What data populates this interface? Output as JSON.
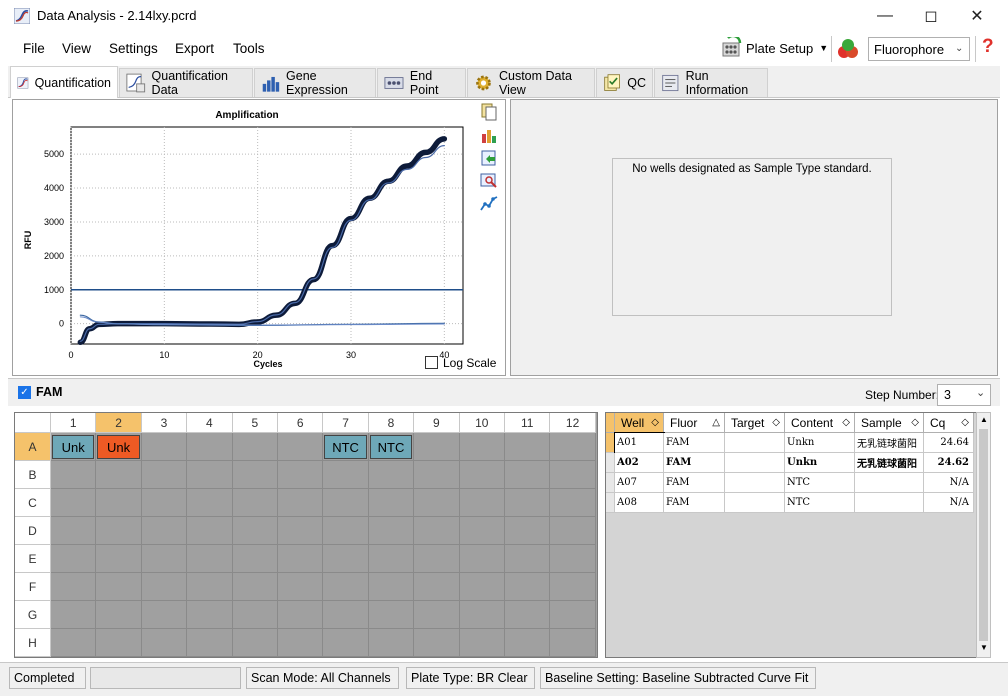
{
  "window": {
    "title": "Data Analysis - 2.14lxy.pcrd"
  },
  "menu": [
    "File",
    "View",
    "Settings",
    "Export",
    "Tools"
  ],
  "toolbar": {
    "plate_setup": "Plate Setup",
    "fluorophore": "Fluorophore"
  },
  "tabs": [
    "Quantification",
    "Quantification Data",
    "Gene Expression",
    "End Point",
    "Custom Data View",
    "QC",
    "Run Information"
  ],
  "chart": {
    "title": "Amplification",
    "xlabel": "Cycles",
    "ylabel": "RFU",
    "yticks": [
      "5000",
      "4000",
      "3000",
      "2000",
      "1000",
      "0"
    ],
    "xticks": [
      "0",
      "10",
      "20",
      "30",
      "40"
    ],
    "log_scale_label": "Log Scale"
  },
  "chart_data": {
    "type": "line",
    "title": "Amplification",
    "xlabel": "Cycles",
    "ylabel": "RFU",
    "xlim": [
      0,
      42
    ],
    "ylim": [
      -600,
      5800
    ],
    "threshold": 1000,
    "log_scale": false,
    "series": [
      {
        "values_x": [
          1,
          2,
          3,
          5,
          10,
          15,
          18,
          20,
          22,
          24,
          26,
          28,
          30,
          32,
          34,
          36,
          38,
          40
        ],
        "values_y": [
          -550,
          -150,
          -20,
          0,
          0,
          -10,
          -20,
          50,
          250,
          600,
          1300,
          2300,
          3100,
          3700,
          4200,
          4650,
          5050,
          5450
        ]
      },
      {
        "values_x": [
          1,
          2,
          3,
          5,
          10,
          15,
          18,
          20,
          22,
          24,
          26,
          28,
          30,
          32,
          34,
          36,
          38,
          40
        ],
        "values_y": [
          -520,
          -150,
          -20,
          0,
          0,
          -10,
          -15,
          60,
          260,
          620,
          1320,
          2250,
          3050,
          3650,
          4150,
          4550,
          4900,
          5250
        ]
      },
      {
        "values_x": [
          1,
          3,
          5,
          10,
          20,
          30,
          40
        ],
        "values_y": [
          250,
          50,
          0,
          -30,
          -50,
          -20,
          10
        ]
      },
      {
        "values_x": [
          1,
          3,
          5,
          10,
          20,
          30,
          40
        ],
        "values_y": [
          200,
          40,
          -10,
          -30,
          -40,
          -30,
          -10
        ]
      }
    ]
  },
  "standard_panel": {
    "message": "No wells designated as Sample Type standard."
  },
  "fluor_toggle": {
    "label": "FAM",
    "checked": true
  },
  "step": {
    "label": "Step Number:",
    "value": "3"
  },
  "plate": {
    "columns": [
      "1",
      "2",
      "3",
      "4",
      "5",
      "6",
      "7",
      "8",
      "9",
      "10",
      "11",
      "12"
    ],
    "rows": [
      "A",
      "B",
      "C",
      "D",
      "E",
      "F",
      "G",
      "H"
    ],
    "wells": [
      {
        "row": 0,
        "col": 0,
        "label": "Unk",
        "color": "#6ea8b8"
      },
      {
        "row": 0,
        "col": 1,
        "label": "Unk",
        "color": "#ee5a24"
      },
      {
        "row": 0,
        "col": 6,
        "label": "NTC",
        "color": "#6ea8b8"
      },
      {
        "row": 0,
        "col": 7,
        "label": "NTC",
        "color": "#6ea8b8"
      }
    ]
  },
  "results": {
    "headers": [
      "Well",
      "Fluor",
      "Target",
      "Content",
      "Sample",
      "Cq"
    ],
    "rows": [
      {
        "well": "A01",
        "fluor": "FAM",
        "target": "",
        "content": "Unkn",
        "sample": "无乳链球菌阳",
        "cq": "24.64",
        "bold": false
      },
      {
        "well": "A02",
        "fluor": "FAM",
        "target": "",
        "content": "Unkn",
        "sample": "无乳链球菌阳",
        "cq": "24.62",
        "bold": true
      },
      {
        "well": "A07",
        "fluor": "FAM",
        "target": "",
        "content": "NTC",
        "sample": "",
        "cq": "N/A",
        "bold": false
      },
      {
        "well": "A08",
        "fluor": "FAM",
        "target": "",
        "content": "NTC",
        "sample": "",
        "cq": "N/A",
        "bold": false
      }
    ]
  },
  "status": {
    "state": "Completed",
    "scan_mode": "Scan Mode: All Channels",
    "plate_type": "Plate Type: BR Clear",
    "baseline": "Baseline Setting: Baseline Subtracted Curve Fit"
  }
}
